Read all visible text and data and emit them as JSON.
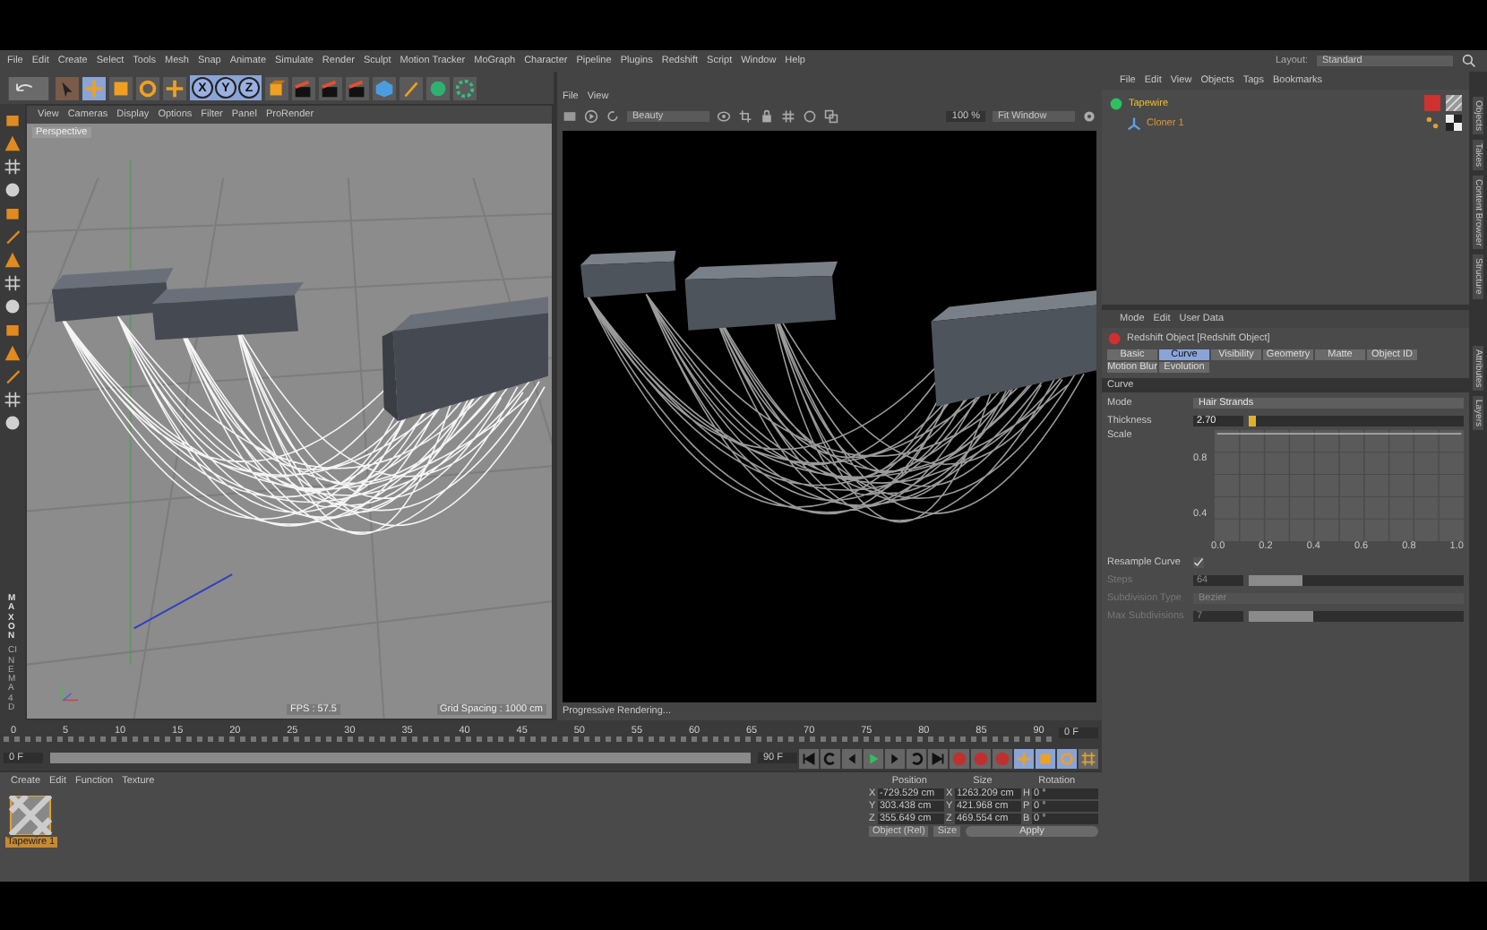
{
  "menu": [
    "File",
    "Edit",
    "Create",
    "Select",
    "Tools",
    "Mesh",
    "Snap",
    "Animate",
    "Simulate",
    "Render",
    "Sculpt",
    "Motion Tracker",
    "MoGraph",
    "Character",
    "Pipeline",
    "Plugins",
    "Redshift",
    "Script",
    "Window",
    "Help"
  ],
  "layout": {
    "label": "Layout:",
    "value": "Standard"
  },
  "toolbar": {
    "axes": [
      "X",
      "Y",
      "Z"
    ]
  },
  "viewport": {
    "menu": [
      "View",
      "Cameras",
      "Display",
      "Options",
      "Filter",
      "Panel",
      "ProRender"
    ],
    "camera": "Perspective",
    "fps": "FPS : 57.5",
    "grid": "Grid Spacing : 1000 cm"
  },
  "logo": [
    "MAXON",
    "CINEMA 4D"
  ],
  "render_view": {
    "menu": [
      "File",
      "View"
    ],
    "channel": "Beauty",
    "zoom": "100 %",
    "fit": "Fit Window",
    "status": "Progressive Rendering..."
  },
  "timeline": {
    "ticks": [
      "0",
      "5",
      "10",
      "15",
      "20",
      "25",
      "30",
      "35",
      "40",
      "45",
      "50",
      "55",
      "60",
      "65",
      "70",
      "75",
      "80",
      "85",
      "90"
    ],
    "current": "0 F",
    "start": "0 F",
    "end": "90 F",
    "range": {
      "level": 1
    }
  },
  "objects": {
    "menu": [
      "File",
      "Edit",
      "View",
      "Objects",
      "Tags",
      "Bookmarks"
    ],
    "items": [
      {
        "name": "Tapewire",
        "children": [
          {
            "name": "Cloner 1"
          }
        ]
      }
    ]
  },
  "side_tabs_top": [
    "Objects",
    "Takes",
    "Content Browser",
    "Structure"
  ],
  "side_tabs_bottom": [
    "Attributes",
    "Layers"
  ],
  "attributes": {
    "menu": [
      "Mode",
      "Edit",
      "User Data"
    ],
    "title": "Redshift Object [Redshift Object]",
    "tabs": [
      {
        "label": "Basic",
        "selected": false
      },
      {
        "label": "Curve",
        "selected": true
      },
      {
        "label": "Visibility",
        "selected": false
      },
      {
        "label": "Geometry",
        "selected": false
      },
      {
        "label": "Matte",
        "selected": false
      },
      {
        "label": "Object ID",
        "selected": false
      },
      {
        "label": "Motion Blur",
        "selected": false
      },
      {
        "label": "Evolution",
        "selected": false
      }
    ],
    "section": "Curve",
    "fields": [
      {
        "kind": "dropdown",
        "label": "Mode",
        "value": "Hair Strands",
        "disabled": false
      },
      {
        "kind": "slider",
        "label": "Thickness",
        "value": "2.70",
        "level": 0.03,
        "disabled": false
      },
      {
        "kind": "graph",
        "label": "Scale",
        "xticks": [
          "0.0",
          "0.2",
          "0.4",
          "0.6",
          "0.8",
          "1.0"
        ],
        "yticks": [
          "0.8",
          "0.4"
        ]
      },
      {
        "kind": "checkbox",
        "label": "Resample Curve",
        "checked": true
      },
      {
        "kind": "slider",
        "label": "Steps",
        "value": "64",
        "level": 0.25,
        "disabled": true
      },
      {
        "kind": "dropdown",
        "label": "Subdivision Type",
        "value": "Bezier",
        "disabled": true
      },
      {
        "kind": "slider",
        "label": "Max Subdivisions",
        "value": "7",
        "level": 0.3,
        "disabled": true
      }
    ]
  },
  "materials": {
    "menu": [
      "Create",
      "Edit",
      "Function",
      "Texture"
    ],
    "items": [
      {
        "name": "Tapewire 1"
      }
    ]
  },
  "coordinates": {
    "headers": [
      "Position",
      "Size",
      "Rotation"
    ],
    "rows": [
      {
        "axis": "X",
        "position": "-729.529 cm",
        "size_axis": "X",
        "size": "1263.209 cm",
        "rot_axis": "H",
        "rotation": "0 °"
      },
      {
        "axis": "Y",
        "position": "303.438 cm",
        "size_axis": "Y",
        "size": "421.968 cm",
        "rot_axis": "P",
        "rotation": "0 °"
      },
      {
        "axis": "Z",
        "position": "355.649 cm",
        "size_axis": "Z",
        "size": "469.554 cm",
        "rot_axis": "B",
        "rotation": "0 °"
      }
    ],
    "mode": "Object (Rel)",
    "size_mode": "Size",
    "apply": "Apply"
  }
}
